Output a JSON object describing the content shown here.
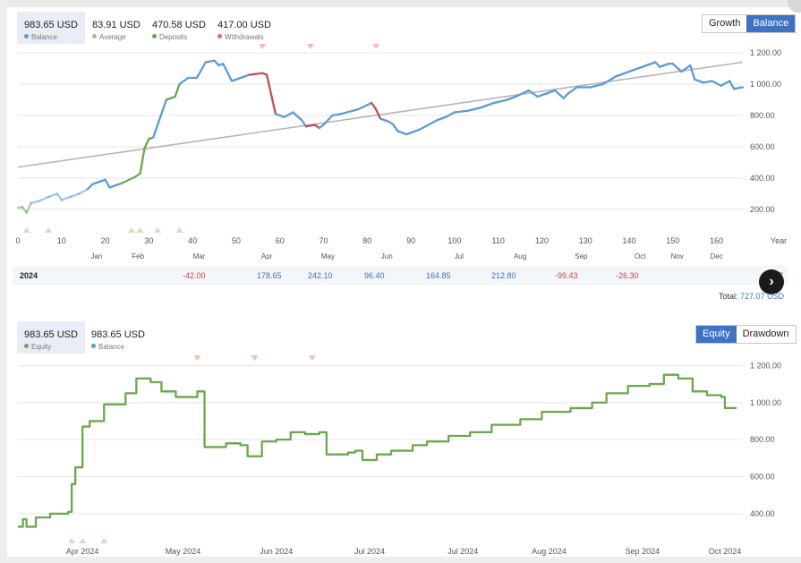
{
  "top_stats": [
    {
      "value": "983.65 USD",
      "label": "Balance",
      "dot": "#5b9bd5",
      "selected": true
    },
    {
      "value": "83.91 USD",
      "label": "Average",
      "dot": "#b0b0b0",
      "selected": false
    },
    {
      "value": "470.58 USD",
      "label": "Deposits",
      "dot": "#6aa84f",
      "selected": false
    },
    {
      "value": "417.00 USD",
      "label": "Withdrawals",
      "dot": "#e06666",
      "selected": false
    }
  ],
  "top_toggle": {
    "growth": "Growth",
    "balance": "Balance"
  },
  "bottom_stats": [
    {
      "value": "983.65 USD",
      "label": "Equity",
      "dot": "#6aa84f",
      "selected": true
    },
    {
      "value": "983.65 USD",
      "label": "Balance",
      "dot": "#5b9bd5",
      "selected": false
    }
  ],
  "bottom_toggle": {
    "equity": "Equity",
    "drawdown": "Drawdown"
  },
  "yearly": {
    "year": "2024",
    "items": [
      {
        "value": "-42.00",
        "color": "#cc4444"
      },
      {
        "value": "178.65",
        "color": "#3f72c2"
      },
      {
        "value": "242.10",
        "color": "#3f72c2"
      },
      {
        "value": "96.40",
        "color": "#3f72c2"
      },
      {
        "value": "164.85",
        "color": "#3f72c2"
      },
      {
        "value": "212.80",
        "color": "#3f72c2"
      },
      {
        "value": "-99.43",
        "color": "#cc4444"
      },
      {
        "value": "-26.30",
        "color": "#cc4444"
      }
    ],
    "year_total_partial": "7",
    "total_label": "Total:",
    "total_value": "727.07 USD"
  },
  "colors": {
    "balance": "#5b9bd5",
    "deposit": "#6aa84f",
    "withdrawal": "#c0504d",
    "trend": "#b5b5b5",
    "equity": "#6aa84f",
    "grid": "#e6e6e6"
  },
  "chart_data": [
    {
      "type": "line",
      "title": "",
      "xlabel": "",
      "ylabel": "",
      "x_ticks": [
        0,
        10,
        20,
        30,
        40,
        50,
        60,
        70,
        80,
        90,
        100,
        110,
        120,
        130,
        140,
        150,
        160
      ],
      "x_extra_tick": "Year",
      "month_labels": [
        {
          "label": "Jan",
          "x": 18
        },
        {
          "label": "Feb",
          "x": 27.5
        },
        {
          "label": "Mar",
          "x": 41.5
        },
        {
          "label": "Apr",
          "x": 57
        },
        {
          "label": "May",
          "x": 71
        },
        {
          "label": "Jun",
          "x": 84.5
        },
        {
          "label": "Jul",
          "x": 101
        },
        {
          "label": "Aug",
          "x": 115
        },
        {
          "label": "Sep",
          "x": 129
        },
        {
          "label": "Oct",
          "x": 142.5
        },
        {
          "label": "Nov",
          "x": 151
        },
        {
          "label": "Dec",
          "x": 160
        }
      ],
      "y_ticks": [
        200,
        400,
        600,
        800,
        1000,
        1200
      ],
      "y_tick_labels": [
        "200.00",
        "400.00",
        "600.00",
        "800.00",
        "1 000.00",
        "1 200.00"
      ],
      "xlim": [
        0,
        165
      ],
      "ylim": [
        80,
        1280
      ],
      "series": [
        {
          "points": [
            [
              0,
              210
            ],
            [
              1,
              215
            ],
            [
              2,
              180
            ],
            [
              3,
              240
            ],
            [
              5,
              255
            ],
            [
              7,
              280
            ],
            [
              9,
              300
            ],
            [
              10,
              260
            ],
            [
              12,
              280
            ],
            [
              14,
              300
            ],
            [
              16,
              330
            ],
            [
              17,
              360
            ],
            [
              19,
              380
            ],
            [
              20,
              390
            ],
            [
              21,
              340
            ],
            [
              24,
              370
            ],
            [
              27,
              410
            ],
            [
              28,
              430
            ],
            [
              29,
              590
            ],
            [
              30,
              650
            ],
            [
              31,
              660
            ],
            [
              32,
              740
            ],
            [
              34,
              900
            ],
            [
              36,
              920
            ],
            [
              37,
              1000
            ],
            [
              39,
              1040
            ],
            [
              41,
              1040
            ],
            [
              43,
              1140
            ],
            [
              45,
              1150
            ],
            [
              46,
              1120
            ],
            [
              47,
              1130
            ],
            [
              49,
              1020
            ],
            [
              51,
              1040
            ],
            [
              53,
              1060
            ],
            [
              56,
              1070
            ],
            [
              57,
              1060
            ],
            [
              59,
              810
            ],
            [
              61,
              790
            ],
            [
              63,
              820
            ],
            [
              65,
              770
            ],
            [
              66,
              730
            ],
            [
              68,
              740
            ],
            [
              69,
              720
            ],
            [
              70,
              740
            ],
            [
              72,
              800
            ],
            [
              74,
              810
            ],
            [
              78,
              840
            ],
            [
              81,
              880
            ],
            [
              82,
              840
            ],
            [
              83,
              780
            ],
            [
              85,
              760
            ],
            [
              86,
              740
            ],
            [
              87,
              700
            ],
            [
              89,
              680
            ],
            [
              92,
              710
            ],
            [
              94,
              740
            ],
            [
              96,
              770
            ],
            [
              98,
              790
            ],
            [
              100,
              820
            ],
            [
              103,
              830
            ],
            [
              106,
              850
            ],
            [
              109,
              880
            ],
            [
              112,
              900
            ],
            [
              114,
              920
            ],
            [
              117,
              960
            ],
            [
              119,
              920
            ],
            [
              121,
              940
            ],
            [
              123,
              960
            ],
            [
              125,
              910
            ],
            [
              126,
              940
            ],
            [
              128,
              980
            ],
            [
              131,
              980
            ],
            [
              134,
              1000
            ],
            [
              137,
              1050
            ],
            [
              140,
              1080
            ],
            [
              143,
              1110
            ],
            [
              146,
              1140
            ],
            [
              147,
              1110
            ],
            [
              149,
              1130
            ],
            [
              150,
              1130
            ],
            [
              152,
              1080
            ],
            [
              154,
              1120
            ],
            [
              155,
              1030
            ],
            [
              157,
              1010
            ],
            [
              159,
              1020
            ],
            [
              161,
              990
            ],
            [
              163,
              1020
            ],
            [
              164,
              970
            ],
            [
              166,
              980
            ]
          ],
          "withdrawal_ranges": [
            [
              56,
              59
            ],
            [
              67,
              69
            ],
            [
              82,
              83
            ]
          ],
          "deposit_ranges": [
            [
              1,
              4
            ],
            [
              27,
              31
            ],
            [
              35,
              38
            ]
          ]
        },
        {
          "points": [
            [
              0,
              470
            ],
            [
              166,
              1140
            ]
          ]
        }
      ],
      "deposit_markers_x": [
        26,
        28,
        32,
        37,
        2,
        7
      ],
      "withdrawal_markers_x": [
        56,
        67,
        82
      ]
    },
    {
      "type": "line",
      "title": "",
      "xlabel": "",
      "ylabel": "",
      "x_tick_labels": [
        "Apr 2024",
        "May 2024",
        "Jun 2024",
        "Jul 2024",
        "Jul 2024",
        "Aug 2024",
        "Sep 2024",
        "Oct 2024"
      ],
      "x_tick_fracs": [
        0.09,
        0.23,
        0.36,
        0.49,
        0.62,
        0.74,
        0.87,
        0.99
      ],
      "y_ticks": [
        400,
        600,
        800,
        1000,
        1200
      ],
      "y_tick_labels": [
        "400.00",
        "600.00",
        "800.00",
        "1 000.00",
        "1 200.00"
      ],
      "ylim": [
        250,
        1250
      ],
      "series": [
        {
          "points": [
            [
              0,
              330
            ],
            [
              0.007,
              370
            ],
            [
              0.012,
              330
            ],
            [
              0.025,
              380
            ],
            [
              0.045,
              400
            ],
            [
              0.07,
              410
            ],
            [
              0.075,
              560
            ],
            [
              0.08,
              650
            ],
            [
              0.09,
              870
            ],
            [
              0.1,
              900
            ],
            [
              0.12,
              990
            ],
            [
              0.15,
              1050
            ],
            [
              0.165,
              1130
            ],
            [
              0.185,
              1110
            ],
            [
              0.2,
              1060
            ],
            [
              0.22,
              1030
            ],
            [
              0.25,
              1060
            ],
            [
              0.26,
              760
            ],
            [
              0.29,
              780
            ],
            [
              0.31,
              770
            ],
            [
              0.32,
              710
            ],
            [
              0.34,
              790
            ],
            [
              0.36,
              800
            ],
            [
              0.38,
              840
            ],
            [
              0.4,
              830
            ],
            [
              0.42,
              840
            ],
            [
              0.43,
              720
            ],
            [
              0.46,
              730
            ],
            [
              0.47,
              740
            ],
            [
              0.48,
              690
            ],
            [
              0.5,
              720
            ],
            [
              0.52,
              740
            ],
            [
              0.55,
              770
            ],
            [
              0.57,
              790
            ],
            [
              0.6,
              820
            ],
            [
              0.63,
              840
            ],
            [
              0.66,
              880
            ],
            [
              0.7,
              910
            ],
            [
              0.73,
              950
            ],
            [
              0.77,
              970
            ],
            [
              0.8,
              1000
            ],
            [
              0.82,
              1050
            ],
            [
              0.85,
              1090
            ],
            [
              0.88,
              1100
            ],
            [
              0.9,
              1150
            ],
            [
              0.92,
              1130
            ],
            [
              0.93,
              1130
            ],
            [
              0.94,
              1060
            ],
            [
              0.96,
              1040
            ],
            [
              0.98,
              1030
            ],
            [
              0.985,
              970
            ],
            [
              1,
              975
            ]
          ]
        }
      ],
      "deposit_markers_frac": [
        0.075,
        0.09,
        0.12
      ],
      "withdrawal_markers_frac": [
        0.25,
        0.33,
        0.41
      ]
    }
  ]
}
